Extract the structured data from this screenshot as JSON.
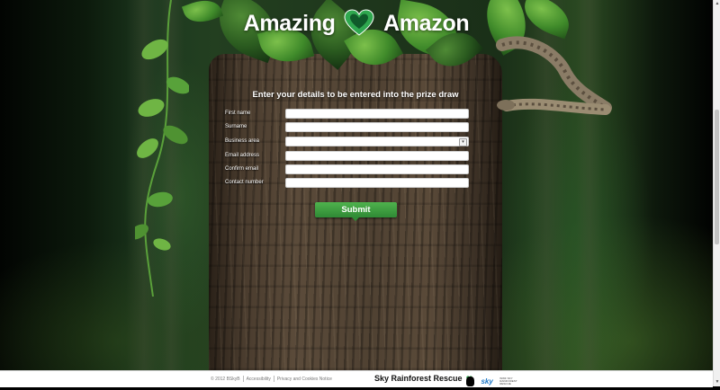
{
  "logo": {
    "word_left": "Amazing",
    "word_right": "Amazon",
    "heart_color": "#2fa84f"
  },
  "form": {
    "title": "Enter your details to be entered into the prize draw",
    "fields": [
      {
        "label": "First name",
        "value": ""
      },
      {
        "label": "Surname",
        "value": ""
      },
      {
        "label": "Business area",
        "value": "",
        "type": "select"
      },
      {
        "label": "Email address",
        "value": ""
      },
      {
        "label": "Confirm email",
        "value": ""
      },
      {
        "label": "Contact number",
        "value": ""
      }
    ],
    "submit_label": "Submit",
    "accent_color": "#3a9a3e"
  },
  "footer": {
    "copyright": "© 2012 BSkyB",
    "accessibility": "Accessibility",
    "privacy": "Privacy and Cookies Notice",
    "brand": "Sky Rainforest Rescue",
    "partner_sky": "sky",
    "partner_tiny": "WWF SKY RAINFOREST RESCUE"
  },
  "scrollbar": {
    "up_icon": "▲",
    "down_icon": "▼"
  },
  "select_arrow": "▾"
}
